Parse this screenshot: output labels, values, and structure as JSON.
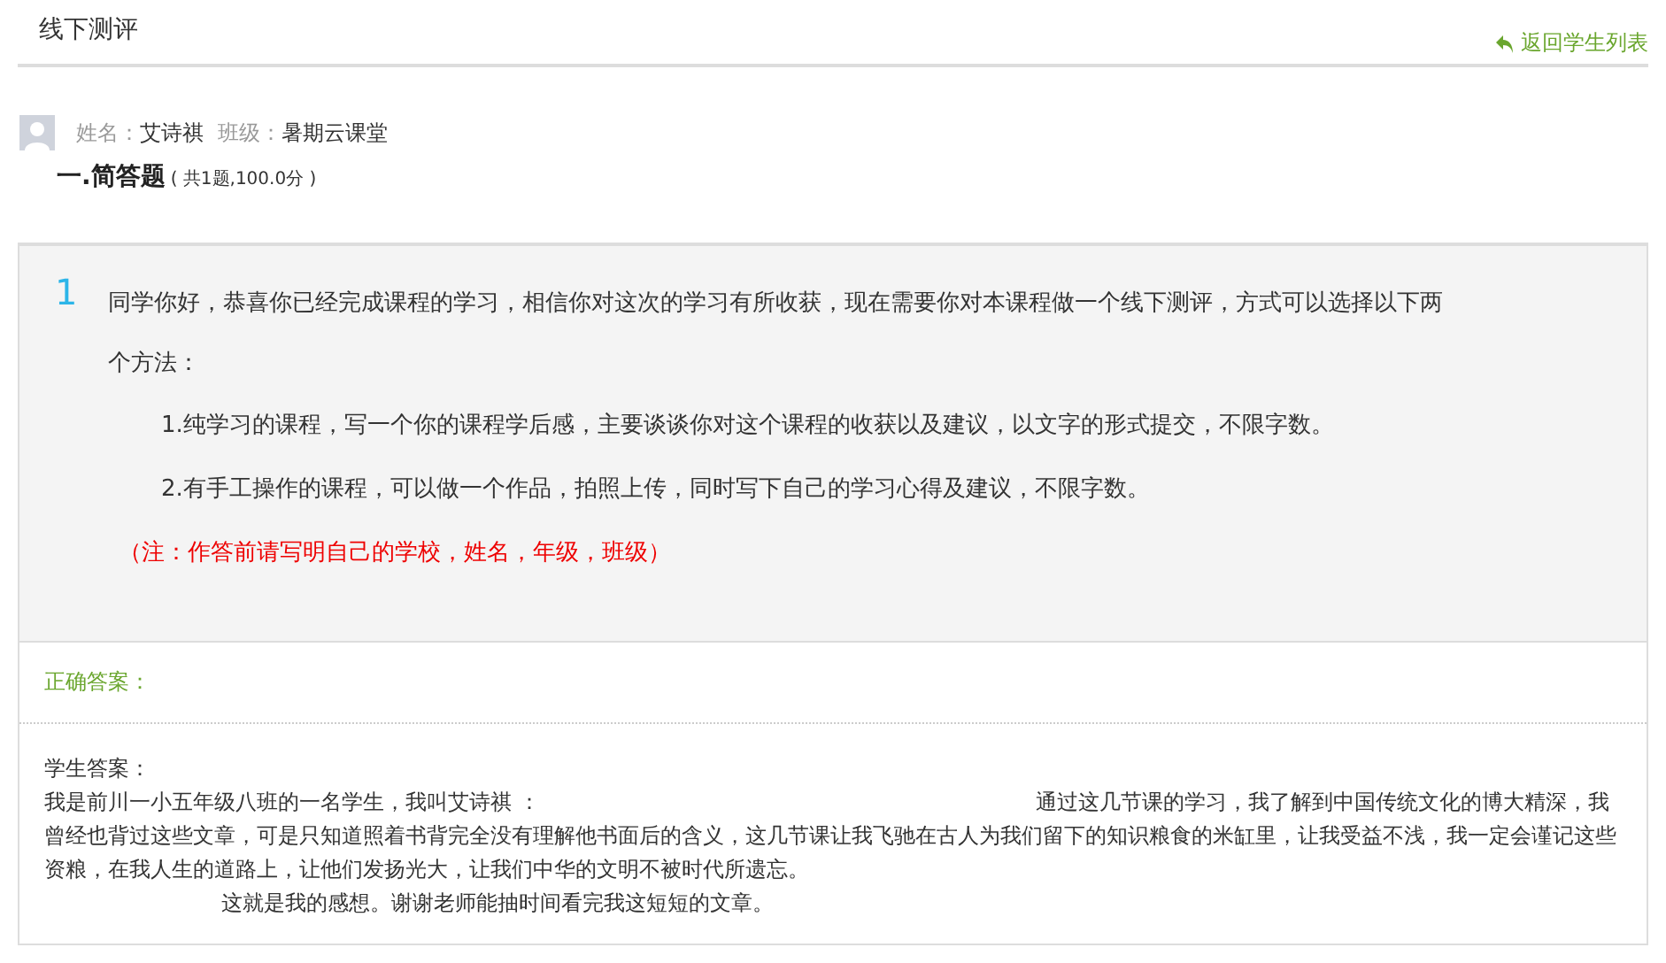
{
  "header": {
    "title": "线下测评",
    "back_link": "返回学生列表"
  },
  "student": {
    "name_label": "姓名：",
    "name": "艾诗祺",
    "class_label": "班级：",
    "class": "暑期云课堂"
  },
  "section": {
    "title": "一.简答题",
    "note": "( 共1题,100.0分 )"
  },
  "question": {
    "number": "1",
    "text": "同学你好，恭喜你已经完成课程的学习，相信你对这次的学习有所收获，现在需要你对本课程做一个线下测评，方式可以选择以下两个方法：",
    "options": [
      "1.纯学习的课程，写一个你的课程学后感，主要谈谈你对这个课程的收获以及建议，以文字的形式提交，不限字数。",
      "2.有手工操作的课程，可以做一个作品，拍照上传，同时写下自己的学习心得及建议，不限字数。"
    ],
    "note": "（注：作答前请写明自己的学校，姓名，年级，班级）"
  },
  "correct_answer": {
    "label": "正确答案："
  },
  "student_answer": {
    "label": "学生答案：",
    "intro": "我是前川一小五年级八班的一名学生，我叫艾诗祺 ：",
    "body": "通过这几节课的学习，我了解到中国传统文化的博大精深，我曾经也背过这些文章，可是只知道照着书背完全没有理解他书面后的含义，这几节课让我飞驰在古人为我们留下的知识粮食的米缸里，让我受益不浅，我一定会谨记这些资粮，在我人生的道路上，让他们发扬光大，让我们中华的文明不被时代所遗忘。",
    "closing": "这就是我的感想。谢谢老师能抽时间看完我这短短的文章。"
  }
}
